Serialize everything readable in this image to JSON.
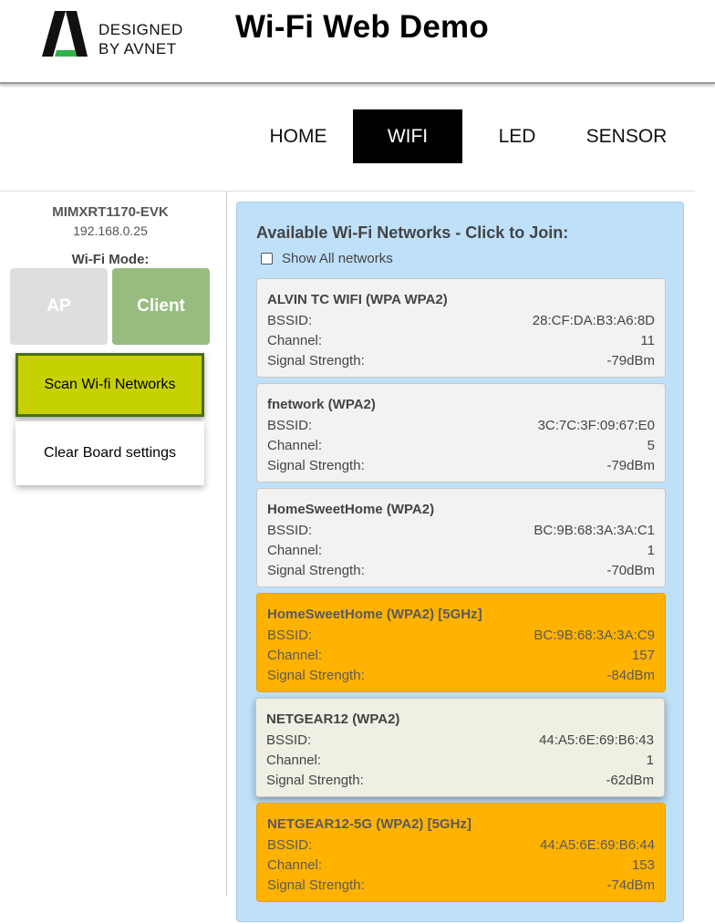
{
  "header": {
    "logo_line1": "DESIGNED",
    "logo_line2": "BY AVNET",
    "title": "Wi-Fi Web Demo"
  },
  "nav": {
    "items": [
      {
        "label": "HOME"
      },
      {
        "label": "WIFI",
        "active": true
      },
      {
        "label": "LED"
      },
      {
        "label": "SENSOR"
      }
    ]
  },
  "sidebar": {
    "device_name": "MIMXRT1170-EVK",
    "device_ip": "192.168.0.25",
    "mode_label": "Wi-Fi Mode:",
    "mode_ap": "AP",
    "mode_client": "Client",
    "scan_button": "Scan Wi-fi Networks",
    "clear_button": "Clear Board settings"
  },
  "panel": {
    "title": "Available Wi-Fi Networks - Click to Join:",
    "show_all_label": "Show All networks",
    "show_all_checked": false,
    "labels": {
      "bssid": "BSSID:",
      "channel": "Channel:",
      "signal": "Signal Strength:"
    },
    "networks": [
      {
        "name": "ALVIN TC WIFI (WPA WPA2)",
        "bssid": "28:CF:DA:B3:A6:8D",
        "channel": "11",
        "signal": "-79dBm",
        "band": "2.4"
      },
      {
        "name": "fnetwork (WPA2)",
        "bssid": "3C:7C:3F:09:67:E0",
        "channel": "5",
        "signal": "-79dBm",
        "band": "2.4"
      },
      {
        "name": "HomeSweetHome (WPA2)",
        "bssid": "BC:9B:68:3A:3A:C1",
        "channel": "1",
        "signal": "-70dBm",
        "band": "2.4"
      },
      {
        "name": "HomeSweetHome (WPA2) [5GHz]",
        "bssid": "BC:9B:68:3A:3A:C9",
        "channel": "157",
        "signal": "-84dBm",
        "band": "5"
      },
      {
        "name": "NETGEAR12 (WPA2)",
        "bssid": "44:A5:6E:69:B6:43",
        "channel": "1",
        "signal": "-62dBm",
        "band": "2.4",
        "hover": true
      },
      {
        "name": "NETGEAR12-5G (WPA2) [5GHz]",
        "bssid": "44:A5:6E:69:B6:44",
        "channel": "153",
        "signal": "-74dBm",
        "band": "5"
      }
    ]
  },
  "colors": {
    "active_nav": "#000000",
    "client_mode": "#97bc80",
    "ap_mode": "#dedede",
    "scan_button": "#c8d100",
    "panel_bg": "#bfe0f9",
    "network_5ghz": "#ffb200",
    "network_24ghz": "#f2f2f2"
  }
}
